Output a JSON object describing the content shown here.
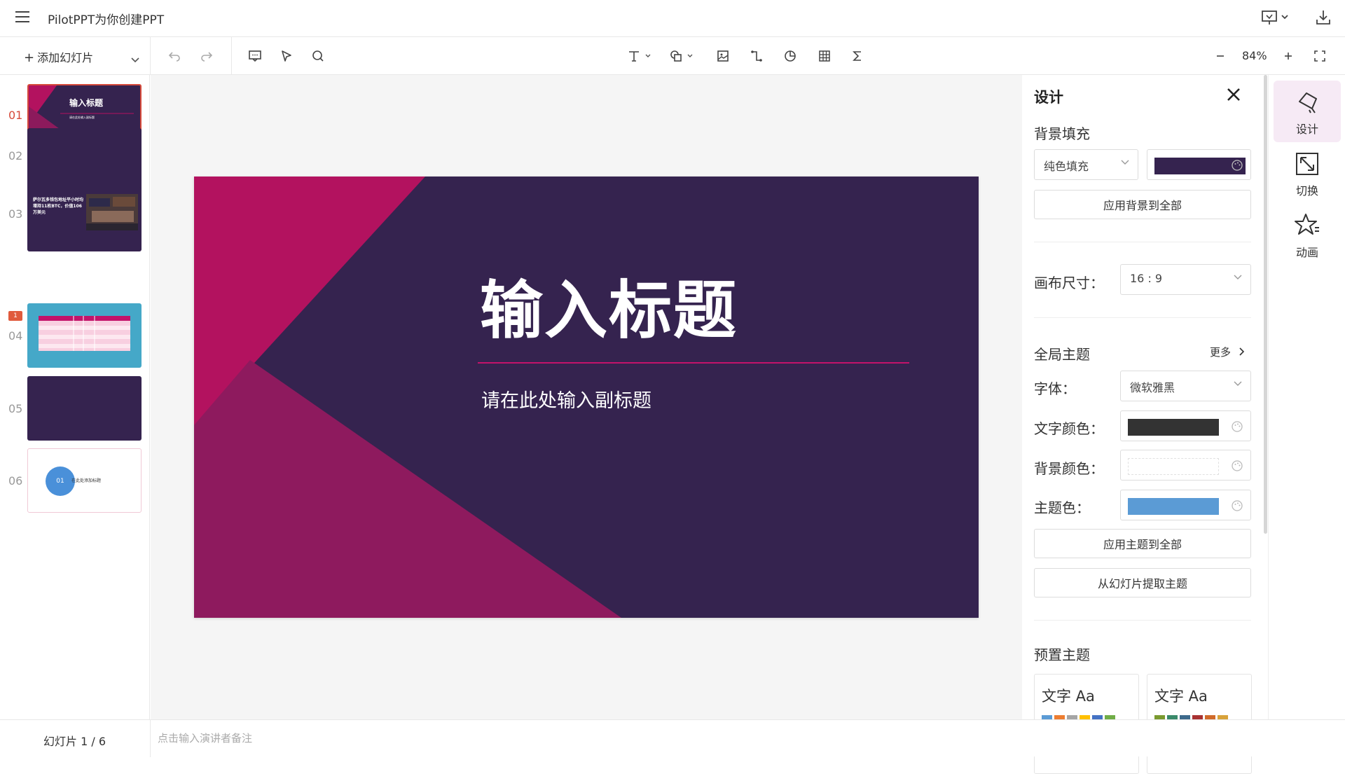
{
  "app": {
    "title": "PilotPPT为你创建PPT"
  },
  "toolbar": {
    "add_slide_label": "添加幻灯片",
    "zoom": "84%"
  },
  "thumbnails": [
    {
      "num": "01",
      "title": "输入标题",
      "subtitle": "请在此处输入副标题",
      "active": true
    },
    {
      "num": "02"
    },
    {
      "num": "03",
      "text": "萨尔瓦多钱包地址平小时均增持11枚BTC，价值106万美元"
    },
    {
      "num": "04",
      "badge": "1"
    },
    {
      "num": "05"
    },
    {
      "num": "06",
      "circle_num": "01",
      "text": "在此处添加标题"
    }
  ],
  "slide": {
    "title": "输入标题",
    "subtitle": "请在此处输入副标题"
  },
  "status": {
    "slide_count": "幻灯片 1 / 6",
    "notes_placeholder": "点击输入演讲者备注"
  },
  "design": {
    "header": "设计",
    "bg_fill_label": "背景填充",
    "fill_type": "纯色填充",
    "fill_color": "#35234f",
    "apply_bg_all": "应用背景到全部",
    "canvas_size_label": "画布尺寸：",
    "canvas_size": "16 : 9",
    "global_theme_label": "全局主题",
    "more_label": "更多",
    "font_label": "字体：",
    "font_value": "微软雅黑",
    "text_color_label": "文字颜色：",
    "text_color": "#333333",
    "bg_color_label": "背景颜色：",
    "theme_color_label": "主题色：",
    "theme_color": "#5b9bd5",
    "apply_theme_all": "应用主题到全部",
    "extract_theme": "从幻灯片提取主题",
    "preset_label": "预置主题",
    "presets": [
      {
        "label": "文字 Aa",
        "colors": [
          "#5b9bd5",
          "#ed7d31",
          "#a5a5a5",
          "#ffc000",
          "#4472c4",
          "#70ad47"
        ]
      },
      {
        "label": "文字 Aa",
        "colors": [
          "#7a9a2f",
          "#3a8a6a",
          "#3e6a8c",
          "#a83232",
          "#d06a2a",
          "#d8a23a"
        ]
      }
    ]
  },
  "right_tabs": [
    {
      "label": "设计",
      "icon": "design-icon"
    },
    {
      "label": "切换",
      "icon": "transition-icon"
    },
    {
      "label": "动画",
      "icon": "animation-icon"
    }
  ]
}
